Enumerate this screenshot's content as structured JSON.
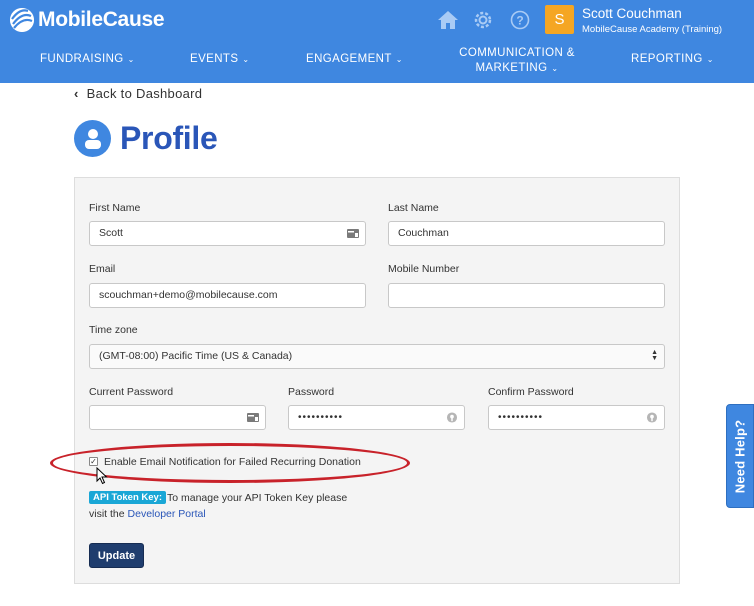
{
  "header": {
    "brand": "MobileCause",
    "icons": [
      "home-icon",
      "gear-icon",
      "help-icon"
    ],
    "user": {
      "avatar_initial": "S",
      "name": "Scott Couchman",
      "org": "MobileCause Academy (Training)"
    },
    "colors": {
      "bar": "#3f87e0",
      "avatar": "#f5a623"
    }
  },
  "nav": {
    "fundraising": "FUNDRAISING",
    "events": "EVENTS",
    "engagement": "ENGAGEMENT",
    "communication_line1": "COMMUNICATION &",
    "communication_line2": "MARKETING",
    "reporting": "REPORTING"
  },
  "page": {
    "back_label": "Back to Dashboard",
    "title": "Profile"
  },
  "form": {
    "first_name": {
      "label": "First Name",
      "value": "Scott"
    },
    "last_name": {
      "label": "Last Name",
      "value": "Couchman"
    },
    "email": {
      "label": "Email",
      "value": "scouchman+demo@mobilecause.com"
    },
    "mobile": {
      "label": "Mobile Number",
      "value": ""
    },
    "timezone": {
      "label": "Time zone",
      "value": "(GMT-08:00) Pacific Time (US & Canada)"
    },
    "current_password": {
      "label": "Current Password",
      "value": ""
    },
    "password": {
      "label": "Password",
      "value": "••••••••••"
    },
    "confirm_password": {
      "label": "Confirm Password",
      "value": "••••••••••"
    },
    "notification": {
      "label": "Enable Email Notification for Failed Recurring Donation",
      "checked": true
    },
    "api": {
      "badge": "API Token Key:",
      "text_line1": "To manage your API Token Key please",
      "text_line2_prefix": "visit the ",
      "link": "Developer Portal"
    },
    "update_label": "Update"
  },
  "help_tab": "Need Help?"
}
